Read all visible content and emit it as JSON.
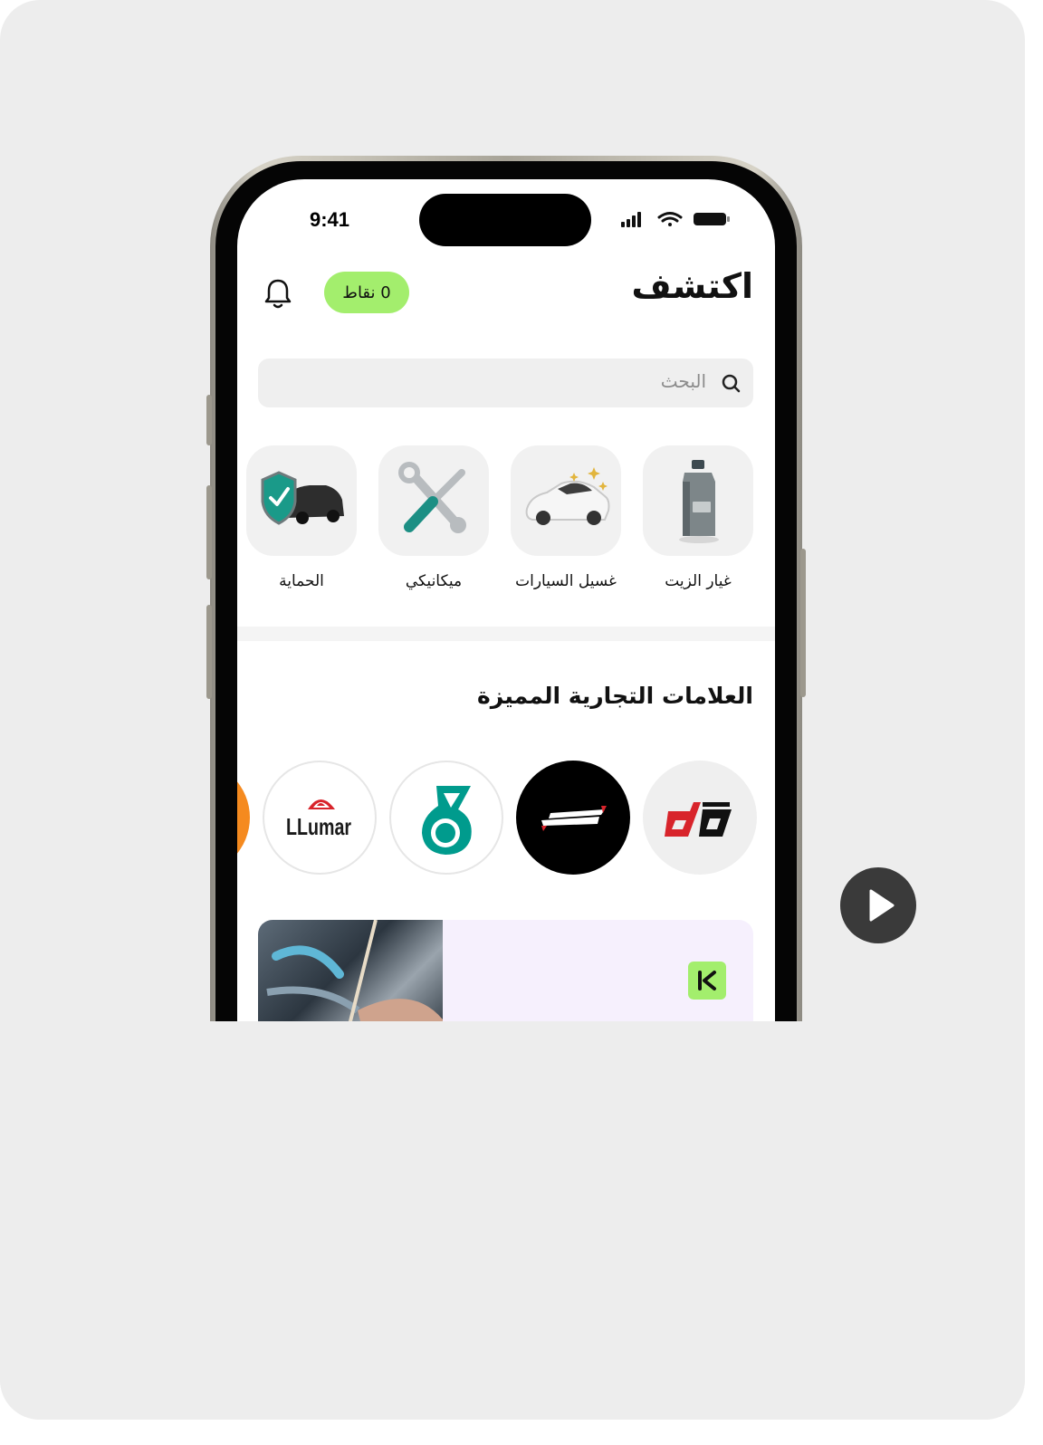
{
  "status_bar": {
    "time": "9:41"
  },
  "header": {
    "title": "اكتشف",
    "points_label": "0 نقاط"
  },
  "search": {
    "placeholder": "البحث"
  },
  "categories": [
    {
      "label": "غيار الزيت",
      "icon": "oil-bottle-icon"
    },
    {
      "label": "غسيل السيارات",
      "icon": "car-wash-icon"
    },
    {
      "label": "ميكانيكي",
      "icon": "tools-icon"
    },
    {
      "label": "الحماية",
      "icon": "shield-car-icon"
    }
  ],
  "brands_section": {
    "title": "العلامات التجارية المميزة"
  },
  "brands": [
    {
      "name": "da",
      "icon": "da-logo"
    },
    {
      "name": "DRIVE7 درايف7",
      "icon": "drive7-logo"
    },
    {
      "name": "petronas",
      "icon": "petronas-logo"
    },
    {
      "name": "LLumar",
      "icon": "llumar-logo"
    }
  ],
  "colors": {
    "accent": "#a3ee6d",
    "background": "#ededed",
    "promo_bg": "#f6f0fd"
  }
}
